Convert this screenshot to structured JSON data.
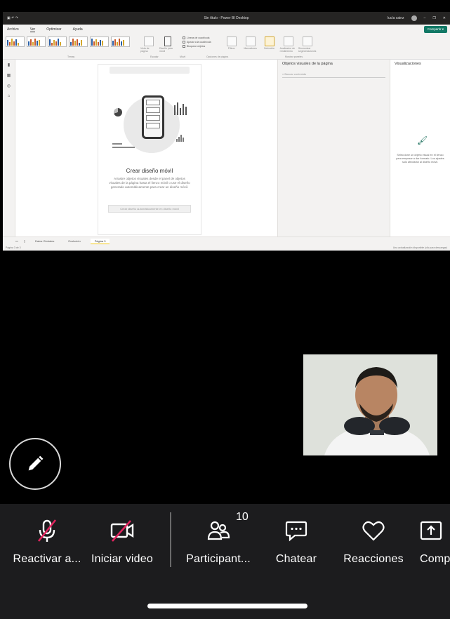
{
  "shared_screen": {
    "window_title": "Sin título - Power BI Desktop",
    "user_name": "lucía sainz",
    "ribbon_tabs": [
      "Archivo",
      "Ver",
      "Optimizar",
      "Ayuda"
    ],
    "active_tab": "Ver",
    "share_label": "Compartir",
    "ribbon_groups": {
      "themes": "Temas",
      "page_options": "Opciones de página",
      "scale": "Escalar",
      "mobile": "Móvil",
      "show_panes": "Mostrar paneles"
    },
    "ribbon_buttons": {
      "page_view": "Vista de página",
      "mobile_layout": "Diseño para móvil",
      "gridlines": "Líneas de cuadrícula",
      "snap_to_grid": "Ajustar a la cuadrícula",
      "lock_objects": "Bloquear objetos",
      "filters": "Filtros",
      "bookmarks": "Marcadores",
      "selection": "Selección",
      "performance": "Analizador de rendimiento",
      "sync_slicers": "Sincronizar segmentaciones"
    },
    "canvas": {
      "title": "Crear diseño móvil",
      "description": "Arrastre objetos visuales desde el panel de objetos visuales de la página hasta el lienzo móvil o use el diseño generado automáticamente para crear un diseño móvil.",
      "auto_button": "Crear diseño automáticamente en diseño móvil"
    },
    "page_visuals_pane": {
      "title": "Objetos visuales de la página",
      "search_placeholder": "Buscar contenido"
    },
    "visualizations_pane": {
      "title": "Visualizaciones",
      "hint": "Seleccione un objeto visual en el lienzo para empezar a dar formato. Los ajustes solo afectarán al diseño móvil."
    },
    "page_tabs": [
      "Datos Globales",
      "Evolución",
      "Página 3"
    ],
    "active_page": "Página 3",
    "status_left": "Página 3 de 3",
    "status_right": "Una actualización disponible (clic para descargar)"
  },
  "annotate_button": {
    "icon": "pencil-icon"
  },
  "toolbar": {
    "items": [
      {
        "label": "Reactivar a...",
        "icon": "mic-muted-icon"
      },
      {
        "label": "Iniciar video",
        "icon": "camera-off-icon"
      },
      {
        "label": "Participant...",
        "icon": "participants-icon",
        "count": "10"
      },
      {
        "label": "Chatear",
        "icon": "chat-icon"
      },
      {
        "label": "Reacciones",
        "icon": "heart-icon"
      },
      {
        "label": "Comp",
        "icon": "share-icon"
      }
    ]
  },
  "colors": {
    "muted_slash": "#e0245e",
    "toolbar_bg": "#1c1c1e",
    "pbi_accent": "#117865",
    "page_tab_accent": "#f2c811"
  }
}
